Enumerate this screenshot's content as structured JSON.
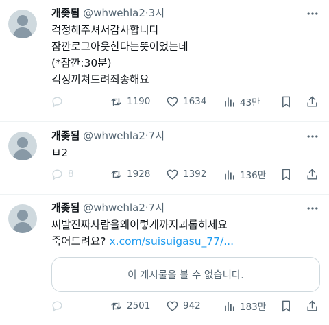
{
  "tweets": [
    {
      "name": "개좆됨",
      "handle": "@whwehla2",
      "dot": "·",
      "time": "3시",
      "lines": [
        "걱정해주셔서감사합니다",
        "잠깐로그아웃한다는뜻이었는데",
        "(*잠깐:30분)",
        "걱정끼쳐드려죄송해요"
      ],
      "replies": "",
      "retweets": "1190",
      "likes": "1634",
      "views": "43만"
    },
    {
      "name": "개좆됨",
      "handle": "@whwehla2",
      "dot": "·",
      "time": "7시",
      "lines": [
        "ㅂ2"
      ],
      "replies": "8",
      "retweets": "1928",
      "likes": "1392",
      "views": "136만"
    },
    {
      "name": "개좆됨",
      "handle": "@whwehla2",
      "dot": "·",
      "time": "7시",
      "lines": [
        "씨발진짜사람을왜이렇게까지괴롭히세요"
      ],
      "line2_text": "죽어드려요?",
      "link": "x.com/suisuigasu_77/...",
      "card_text": "이 게시물을 볼 수 없습니다.",
      "replies": "",
      "retweets": "2501",
      "likes": "942",
      "views": "183만"
    }
  ],
  "icons": {
    "more": "more-icon",
    "reply": "reply-icon",
    "retweet": "retweet-icon",
    "like": "heart-icon",
    "views": "views-icon",
    "bookmark": "bookmark-icon",
    "share": "share-icon"
  },
  "colors": {
    "text": "#0f1419",
    "secondary": "#536471",
    "link": "#1d9bf0",
    "avatar": "#cfd9de",
    "border": "#cfd9de"
  }
}
